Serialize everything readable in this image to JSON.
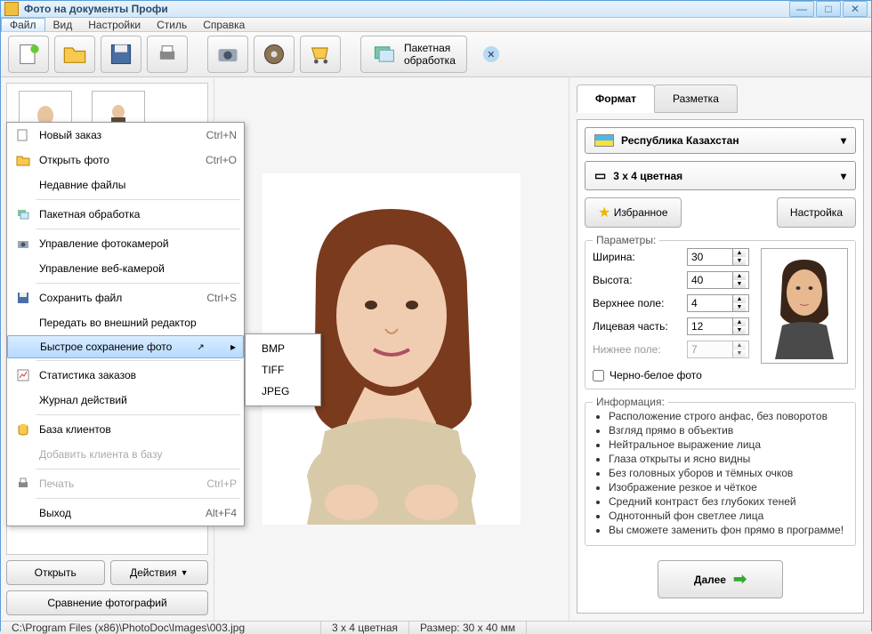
{
  "title": "Фото на документы Профи",
  "menubar": [
    "Файл",
    "Вид",
    "Настройки",
    "Стиль",
    "Справка"
  ],
  "filemenu": [
    {
      "label": "Новый заказ",
      "shortcut": "Ctrl+N",
      "icon": "new"
    },
    {
      "label": "Открыть фото",
      "shortcut": "Ctrl+O",
      "icon": "open"
    },
    {
      "label": "Недавние файлы"
    },
    {
      "sep": true
    },
    {
      "label": "Пакетная обработка",
      "icon": "batch"
    },
    {
      "sep": true
    },
    {
      "label": "Управление фотокамерой",
      "icon": "camera"
    },
    {
      "label": "Управление веб-камерой"
    },
    {
      "sep": true
    },
    {
      "label": "Сохранить файл",
      "shortcut": "Ctrl+S",
      "icon": "save"
    },
    {
      "label": "Передать во внешний редактор"
    },
    {
      "label": "Быстрое сохранение фото",
      "submenu": true,
      "hl": true
    },
    {
      "sep": true
    },
    {
      "label": "Статистика заказов",
      "icon": "stats"
    },
    {
      "label": "Журнал действий"
    },
    {
      "sep": true
    },
    {
      "label": "База клиентов",
      "icon": "db"
    },
    {
      "label": "Добавить клиента в базу",
      "disabled": true
    },
    {
      "sep": true
    },
    {
      "label": "Печать",
      "shortcut": "Ctrl+P",
      "disabled": true,
      "icon": "print"
    },
    {
      "sep": true
    },
    {
      "label": "Выход",
      "shortcut": "Alt+F4"
    }
  ],
  "submenu": [
    "BMP",
    "TIFF",
    "JPEG"
  ],
  "batch_label": "Пакетная\nобработка",
  "thumbs": [
    {
      "file": "6.jpg"
    },
    {
      "file": "9.jpg"
    }
  ],
  "left_buttons": {
    "open": "Открыть",
    "actions": "Действия",
    "compare": "Сравнение фотографий"
  },
  "tabs": {
    "format": "Формат",
    "layout": "Разметка"
  },
  "country": "Республика Казахстан",
  "format": "3 x 4 цветная",
  "fav": "Избранное",
  "settings": "Настройка",
  "params_title": "Параметры:",
  "params": {
    "width": {
      "label": "Ширина:",
      "value": "30"
    },
    "height": {
      "label": "Высота:",
      "value": "40"
    },
    "top": {
      "label": "Верхнее поле:",
      "value": "4"
    },
    "face": {
      "label": "Лицевая часть:",
      "value": "12"
    },
    "bottom": {
      "label": "Нижнее поле:",
      "value": "7",
      "disabled": true
    }
  },
  "bw": "Черно-белое фото",
  "info_title": "Информация:",
  "info": [
    "Расположение строго анфас, без поворотов",
    "Взгляд прямо в объектив",
    "Нейтральное выражение лица",
    "Глаза открыты и ясно видны",
    "Без головных уборов и тёмных очков",
    "Изображение резкое и чёткое",
    "Средний контраст без глубоких теней",
    "Однотонный фон светлее лица",
    "Вы сможете заменить фон прямо в программе!"
  ],
  "next": "Далее",
  "status": {
    "path": "C:\\Program Files (x86)\\PhotoDoc\\Images\\003.jpg",
    "fmt": "3 x 4 цветная",
    "size": "Размер: 30 x 40 мм"
  }
}
